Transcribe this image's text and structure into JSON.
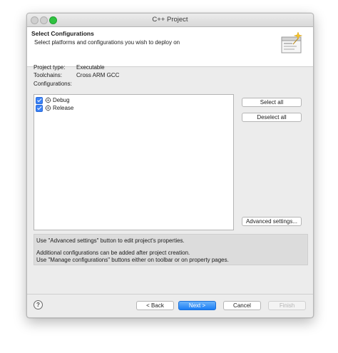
{
  "window": {
    "title": "C++ Project"
  },
  "banner": {
    "title": "Select Configurations",
    "subtitle": "Select platforms and configurations you wish to deploy on",
    "icon": "wizard-icon"
  },
  "info": {
    "project_type_label": "Project type:",
    "project_type_value": "Executable",
    "toolchains_label": "Toolchains:",
    "toolchains_value": "Cross ARM GCC",
    "configurations_label": "Configurations:"
  },
  "configurations": [
    {
      "label": "Debug",
      "checked": true,
      "icon": "configuration-icon"
    },
    {
      "label": "Release",
      "checked": true,
      "icon": "configuration-icon"
    }
  ],
  "side_buttons": {
    "select_all": "Select all",
    "deselect_all": "Deselect all",
    "advanced": "Advanced settings..."
  },
  "message": {
    "line1": "Use \"Advanced settings\" button to edit project's properties.",
    "line2": "Additional configurations can be added after project creation.",
    "line3": "Use \"Manage configurations\" buttons either on toolbar or on property pages."
  },
  "footer": {
    "help": "?",
    "back": "< Back",
    "next": "Next >",
    "cancel": "Cancel",
    "finish": "Finish"
  },
  "colors": {
    "accent": "#1b7ef5",
    "checkbox": "#3b82f6",
    "window_bg": "#ececec"
  }
}
